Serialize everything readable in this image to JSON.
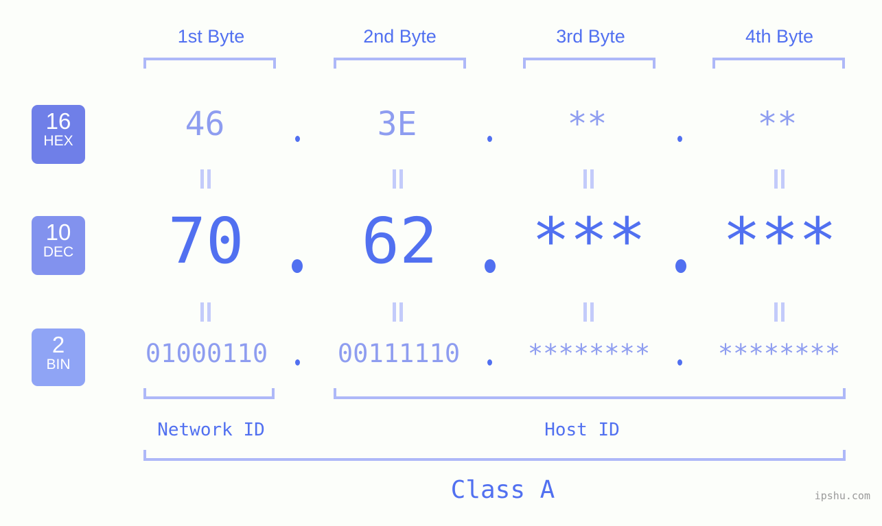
{
  "headers": [
    {
      "label": "1st Byte"
    },
    {
      "label": "2nd Byte"
    },
    {
      "label": "3rd Byte"
    },
    {
      "label": "4th Byte"
    }
  ],
  "rows": [
    {
      "badge_radix": "16",
      "badge_name": "HEX",
      "badge_color": "#6f7fe8",
      "values": [
        "46",
        "3E",
        "**",
        "**"
      ],
      "separator": "."
    },
    {
      "badge_radix": "10",
      "badge_name": "DEC",
      "badge_color": "#8292ee",
      "values": [
        "70",
        "62",
        "***",
        "***"
      ],
      "separator": "."
    },
    {
      "badge_radix": "2",
      "badge_name": "BIN",
      "badge_color": "#8fa4f5",
      "values": [
        "01000110",
        "00111110",
        "********",
        "********"
      ],
      "separator": "."
    }
  ],
  "equals_symbol": "=",
  "segments": {
    "network_id": "Network ID",
    "host_id": "Host ID"
  },
  "class_label": "Class A",
  "watermark": "ipshu.com",
  "colors": {
    "background": "#fcfefa",
    "accent_strong": "#5170f0",
    "accent_light": "#8e9df0",
    "bracket": "#aeb8f8",
    "connector": "#c3cbfa",
    "watermark": "#9a9a9a"
  }
}
